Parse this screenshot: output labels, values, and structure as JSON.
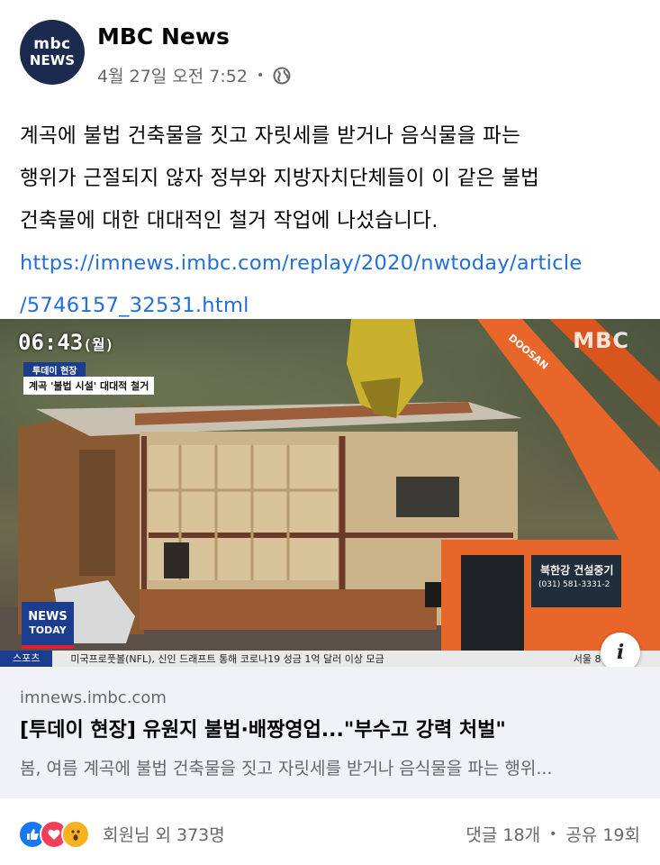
{
  "post": {
    "page_name": "MBC News",
    "avatar": {
      "line1": "mbc",
      "line2": "NEWS"
    },
    "timestamp": "4월 27일 오전 7:52",
    "separator": "•",
    "privacy_icon": "globe-icon",
    "body_lines": [
      "계곡에 불법 건축물을 짓고 자릿세를 받거나 음식물을 파는",
      "행위가 근절되지 않자 정부와 지방자치단체들이 이 같은 불법",
      "건축물에 대한 대대적인 철거 작업에 나섰습니다."
    ],
    "link_lines": [
      "https://imnews.imbc.com/replay/2020/nwtoday/article",
      "/5746157_32531.html"
    ]
  },
  "media": {
    "time": "06:43",
    "day": "(월)",
    "tag_program": "투데이 현장",
    "tag_headline": "계곡 '불법 시설' 대대적 철거",
    "watermark": "MBC",
    "logo_line1": "NEWS",
    "logo_line2": "TODAY",
    "ticker_category": "스포츠",
    "ticker_text": "미국프로풋볼(NFL), 신인 드래프트 통해 코로나19 성금 1억 달러 이상 모금",
    "ticker_right": "서울  8°",
    "excavator_brand": "DOOSAN",
    "excavator_company": "북한강 건설중기",
    "excavator_phone": "(031) 581-3331-2",
    "info_glyph": "i"
  },
  "link_preview": {
    "domain": "imnews.imbc.com",
    "title": "[투데이 현장] 유원지 불법·배짱영업...\"부수고 강력 처벌\"",
    "description": "봄, 여름 계곡에 불법 건축물을 짓고 자릿세를 받거나 음식물을 파는 행위..."
  },
  "footer": {
    "reaction_icons": [
      "like-icon",
      "love-icon",
      "wow-icon"
    ],
    "reactions_text": "회원님 외 373명",
    "comments": "댓글 18개",
    "separator": "•",
    "shares": "공유 19회"
  },
  "colors": {
    "link": "#216fdb",
    "like": "#1877f2",
    "love": "#f33e58",
    "wow": "#f7b125",
    "avatar_bg": "#1b2a4e",
    "excavator": "#e8662a"
  }
}
